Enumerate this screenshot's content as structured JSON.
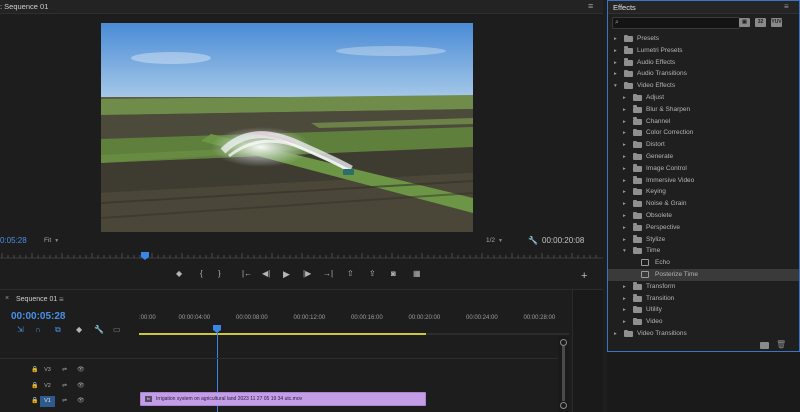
{
  "program_monitor": {
    "title": ": Sequence 01",
    "menu_glyph": "≡",
    "current_timecode": "0:05:28",
    "zoom": "Fit",
    "resolution": "1/2",
    "duration": "00:00:20:08",
    "add_glyph": "+"
  },
  "timeline": {
    "close_glyph": "×",
    "sequence_tab": "Sequence 01",
    "menu_glyph": "≡",
    "timecode": "00:00:05:28",
    "ruler_ticks": [
      ":00:00",
      "00:00:04:00",
      "00:00:08:00",
      "00:00:12:00",
      "00:00:16:00",
      "00:00:20:00",
      "00:00:24:00",
      "00:00:28:00"
    ],
    "tracks": [
      {
        "label": "V3",
        "active": false
      },
      {
        "label": "V2",
        "active": false
      },
      {
        "label": "V1",
        "active": true
      }
    ],
    "clip_label": "Irrigation system on agricultural land 2023 11 27 05 19 34 utc.mov",
    "clip_fx": "fx"
  },
  "effects_panel": {
    "title": "Effects",
    "menu_glyph": "≡",
    "search_value": "",
    "items": [
      {
        "label": "Presets",
        "level": 0,
        "expanded": false,
        "kind": "folder"
      },
      {
        "label": "Lumetri Presets",
        "level": 0,
        "expanded": false,
        "kind": "folder"
      },
      {
        "label": "Audio Effects",
        "level": 0,
        "expanded": false,
        "kind": "folder"
      },
      {
        "label": "Audio Transitions",
        "level": 0,
        "expanded": false,
        "kind": "folder"
      },
      {
        "label": "Video Effects",
        "level": 0,
        "expanded": true,
        "kind": "folder"
      },
      {
        "label": "Adjust",
        "level": 1,
        "expanded": false,
        "kind": "folder"
      },
      {
        "label": "Blur & Sharpen",
        "level": 1,
        "expanded": false,
        "kind": "folder"
      },
      {
        "label": "Channel",
        "level": 1,
        "expanded": false,
        "kind": "folder"
      },
      {
        "label": "Color Correction",
        "level": 1,
        "expanded": false,
        "kind": "folder"
      },
      {
        "label": "Distort",
        "level": 1,
        "expanded": false,
        "kind": "folder"
      },
      {
        "label": "Generate",
        "level": 1,
        "expanded": false,
        "kind": "folder"
      },
      {
        "label": "Image Control",
        "level": 1,
        "expanded": false,
        "kind": "folder"
      },
      {
        "label": "Immersive Video",
        "level": 1,
        "expanded": false,
        "kind": "folder"
      },
      {
        "label": "Keying",
        "level": 1,
        "expanded": false,
        "kind": "folder"
      },
      {
        "label": "Noise & Grain",
        "level": 1,
        "expanded": false,
        "kind": "folder"
      },
      {
        "label": "Obsolete",
        "level": 1,
        "expanded": false,
        "kind": "folder"
      },
      {
        "label": "Perspective",
        "level": 1,
        "expanded": false,
        "kind": "folder"
      },
      {
        "label": "Stylize",
        "level": 1,
        "expanded": false,
        "kind": "folder"
      },
      {
        "label": "Time",
        "level": 1,
        "expanded": true,
        "kind": "folder"
      },
      {
        "label": "Echo",
        "level": 2,
        "expanded": false,
        "kind": "effect"
      },
      {
        "label": "Posterize Time",
        "level": 2,
        "expanded": false,
        "kind": "effect",
        "selected": true
      },
      {
        "label": "Transform",
        "level": 1,
        "expanded": false,
        "kind": "folder"
      },
      {
        "label": "Transition",
        "level": 1,
        "expanded": false,
        "kind": "folder"
      },
      {
        "label": "Utility",
        "level": 1,
        "expanded": false,
        "kind": "folder"
      },
      {
        "label": "Video",
        "level": 1,
        "expanded": false,
        "kind": "folder"
      },
      {
        "label": "Video Transitions",
        "level": 0,
        "expanded": false,
        "kind": "folder"
      }
    ]
  },
  "colors": {
    "accent_blue": "#4a8fe7",
    "playhead": "#3a86e8",
    "work_area": "#c8c83a",
    "clip": "#c39de6",
    "panel_border": "#3a74c4"
  }
}
